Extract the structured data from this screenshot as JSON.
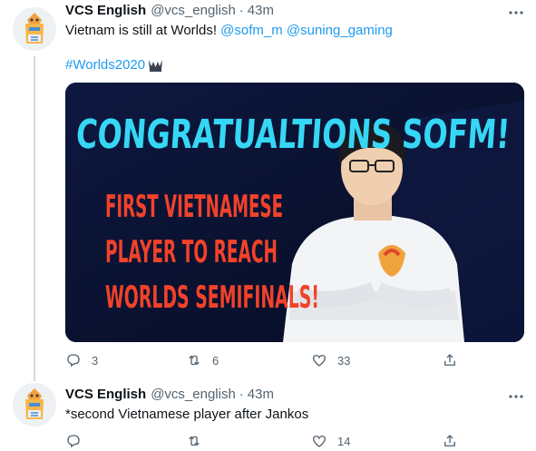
{
  "tweets": [
    {
      "display_name": "VCS English",
      "handle": "@vcs_english",
      "separator": "·",
      "time": "43m",
      "text_prefix": "Vietnam is still at Worlds! ",
      "mention_1": "@sofm_m",
      "mention_2": "@suning_gaming",
      "hashtag": "#Worlds2020",
      "hashtag_emoji": "worlds-trophy-icon",
      "media": {
        "headline": "CONGRATUALTIONS SOFM!",
        "line_1": "FIRST VIETNAMESE",
        "line_2": "PLAYER TO REACH",
        "line_3": "WORLDS SEMIFINALS!",
        "headline_color": "#35d7f5",
        "subtext_color": "#f2422a",
        "background_color": "#0b1230"
      },
      "actions": {
        "reply_count": "3",
        "retweet_count": "6",
        "like_count": "33",
        "share_count": ""
      }
    },
    {
      "display_name": "VCS English",
      "handle": "@vcs_english",
      "separator": "·",
      "time": "43m",
      "text": "*second Vietnamese player after Jankos",
      "actions": {
        "reply_count": "",
        "retweet_count": "",
        "like_count": "14",
        "share_count": ""
      }
    }
  ],
  "colors": {
    "link": "#1d9bf0",
    "secondary_text": "#536471",
    "thread_line": "#cfd9de"
  }
}
